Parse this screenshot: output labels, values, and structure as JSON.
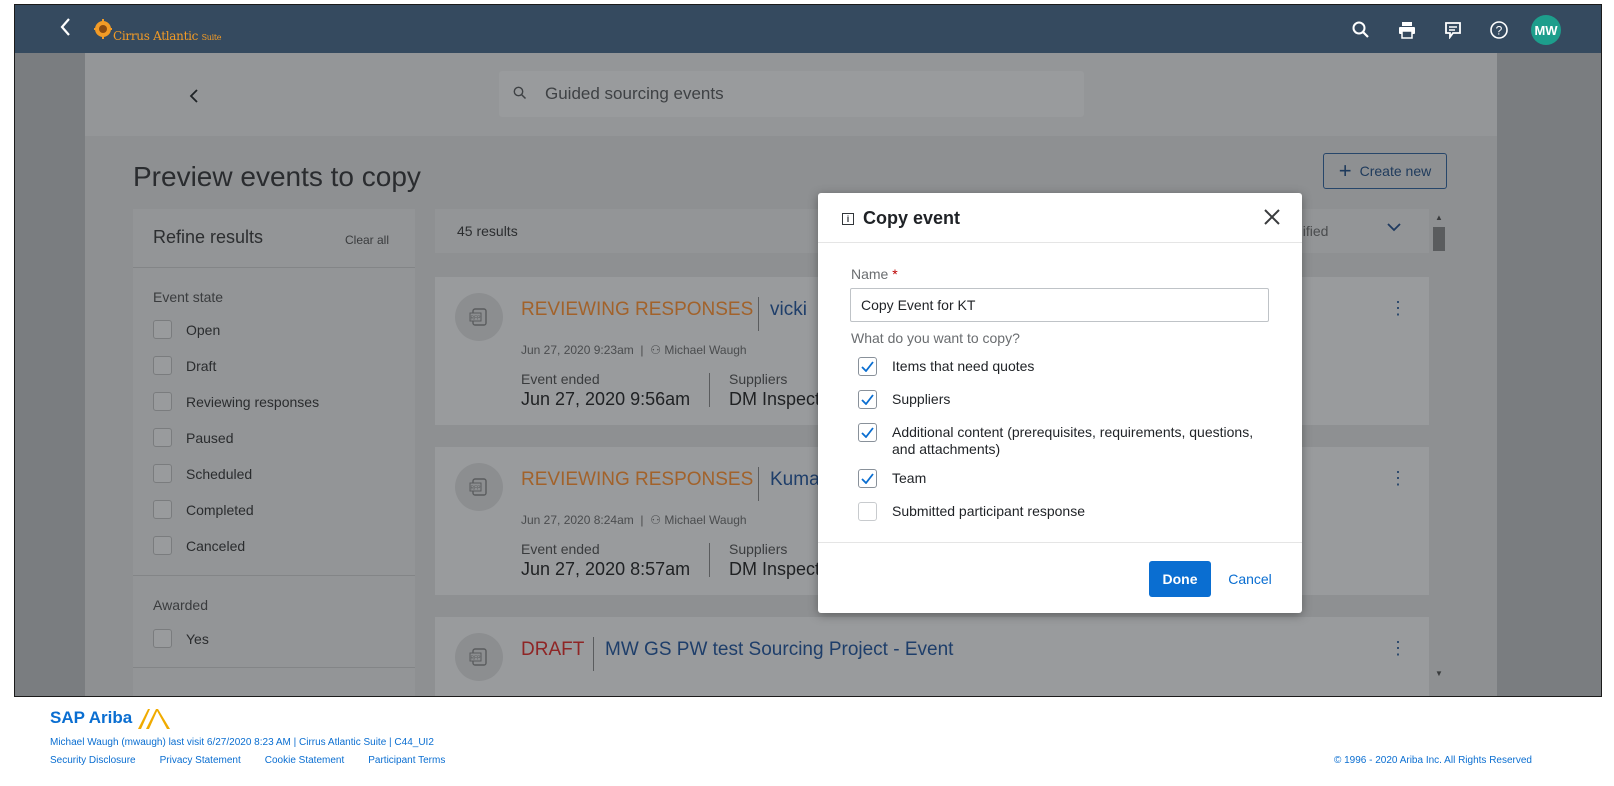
{
  "shell": {
    "logo_text": "Cirrus Atlantic",
    "logo_suffix": "Suite",
    "avatar_initials": "MW",
    "icons": [
      "search-icon",
      "print-icon",
      "feedback-icon",
      "help-icon"
    ]
  },
  "subheader": {
    "search_placeholder": "Guided sourcing events"
  },
  "page": {
    "title": "Preview events to copy",
    "create_label": "Create new"
  },
  "refine": {
    "title": "Refine results",
    "clear_label": "Clear all",
    "event_state_label": "Event state",
    "event_states": [
      "Open",
      "Draft",
      "Reviewing responses",
      "Paused",
      "Scheduled",
      "Completed",
      "Canceled"
    ],
    "awarded_label": "Awarded",
    "awarded_options": [
      "Yes"
    ]
  },
  "results": {
    "count": "45 results",
    "sort_label": "dified"
  },
  "cards": [
    {
      "state": "REVIEWING RESPONSES",
      "name": "vicki",
      "date": "Jun 27, 2020 9:23am",
      "owner": "Michael Waugh",
      "ended_label": "Event ended",
      "ended_value": "Jun 27, 2020 9:56am",
      "suppliers_label": "Suppliers",
      "suppliers_value": "DM Inspect"
    },
    {
      "state": "REVIEWING RESPONSES",
      "name": "Kuma",
      "date": "Jun 27, 2020 8:24am",
      "owner": "Michael Waugh",
      "ended_label": "Event ended",
      "ended_value": "Jun 27, 2020 8:57am",
      "suppliers_label": "Suppliers",
      "suppliers_value": "DM Inspect"
    },
    {
      "state": "DRAFT",
      "name": "MW GS PW test Sourcing Project - Event"
    }
  ],
  "modal": {
    "title": "Copy event",
    "name_label": "Name",
    "name_required_mark": "*",
    "name_value": "Copy Event for KT",
    "question": "What do you want to copy?",
    "options": [
      {
        "label": "Items that need quotes",
        "checked": true
      },
      {
        "label": "Suppliers",
        "checked": true
      },
      {
        "label": "Additional content (prerequisites, requirements, questions, and attachments)",
        "checked": true
      },
      {
        "label": "Team",
        "checked": true
      },
      {
        "label": "Submitted participant response",
        "checked": false
      }
    ],
    "done_label": "Done",
    "cancel_label": "Cancel",
    "primary_color": "#0a6ed1"
  },
  "footer": {
    "brand": "SAP Ariba",
    "last_visit": "Michael Waugh (mwaugh) last visit 6/27/2020 8:23 AM | Cirrus Atlantic Suite | C44_UI2",
    "links": [
      "Security Disclosure",
      "Privacy Statement",
      "Cookie Statement",
      "Participant Terms"
    ],
    "copyright": "© 1996 - 2020 Ariba Inc. All Rights Reserved"
  }
}
